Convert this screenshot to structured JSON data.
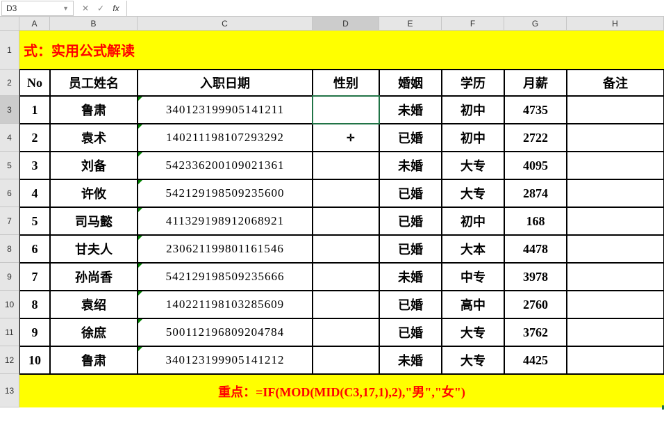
{
  "name_box": "D3",
  "formula_bar": "",
  "columns": [
    "A",
    "B",
    "C",
    "D",
    "E",
    "F",
    "G",
    "H"
  ],
  "selected_col": "D",
  "selected_row": 3,
  "title": "式：实用公式解读",
  "headers": {
    "no": "No",
    "name": "员工姓名",
    "hire": "入职日期",
    "gender": "性别",
    "marriage": "婚姻",
    "edu": "学历",
    "salary": "月薪",
    "remark": "备注"
  },
  "rows": [
    {
      "no": "1",
      "name": "鲁肃",
      "id": "340123199905141211",
      "gender": "",
      "marriage": "未婚",
      "edu": "初中",
      "salary": "4735",
      "remark": ""
    },
    {
      "no": "2",
      "name": "袁术",
      "id": "140211198107293292",
      "gender": "",
      "marriage": "已婚",
      "edu": "初中",
      "salary": "2722",
      "remark": ""
    },
    {
      "no": "3",
      "name": "刘备",
      "id": "542336200109021361",
      "gender": "",
      "marriage": "未婚",
      "edu": "大专",
      "salary": "4095",
      "remark": ""
    },
    {
      "no": "4",
      "name": "许攸",
      "id": "542129198509235600",
      "gender": "",
      "marriage": "已婚",
      "edu": "大专",
      "salary": "2874",
      "remark": ""
    },
    {
      "no": "5",
      "name": "司马懿",
      "id": "411329198912068921",
      "gender": "",
      "marriage": "已婚",
      "edu": "初中",
      "salary": "168",
      "remark": ""
    },
    {
      "no": "6",
      "name": "甘夫人",
      "id": "230621199801161546",
      "gender": "",
      "marriage": "已婚",
      "edu": "大本",
      "salary": "4478",
      "remark": ""
    },
    {
      "no": "7",
      "name": "孙尚香",
      "id": "542129198509235666",
      "gender": "",
      "marriage": "未婚",
      "edu": "中专",
      "salary": "3978",
      "remark": ""
    },
    {
      "no": "8",
      "name": "袁绍",
      "id": "140221198103285609",
      "gender": "",
      "marriage": "已婚",
      "edu": "高中",
      "salary": "2760",
      "remark": ""
    },
    {
      "no": "9",
      "name": "徐庶",
      "id": "500112196809204784",
      "gender": "",
      "marriage": "已婚",
      "edu": "大专",
      "salary": "3762",
      "remark": ""
    },
    {
      "no": "10",
      "name": "鲁肃",
      "id": "340123199905141212",
      "gender": "",
      "marriage": "未婚",
      "edu": "大专",
      "salary": "4425",
      "remark": ""
    }
  ],
  "footer_label": "重点：",
  "footer_formula": "=IF(MOD(MID(C3,17,1),2),\"男\",\"女\")",
  "row_heights": {
    "1": 56,
    "2": 38,
    "data": 40,
    "13": 48
  }
}
